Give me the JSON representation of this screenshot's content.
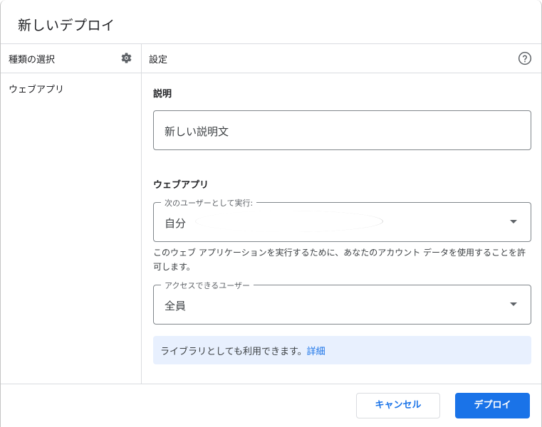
{
  "dialog": {
    "title": "新しいデプロイ"
  },
  "left_panel": {
    "header": "種類の選択",
    "items": [
      "ウェブアプリ"
    ],
    "header_icon": "gear-icon"
  },
  "right_panel": {
    "header": "設定",
    "header_icon": "help-icon",
    "description": {
      "label": "説明",
      "value": "新しい説明文"
    },
    "webapp": {
      "section_label": "ウェブアプリ",
      "execute_as": {
        "legend": "次のユーザーとして実行:",
        "value": "自分"
      },
      "helper_text": "このウェブ アプリケーションを実行するために、あなたのアカウント データを使用することを許可します。",
      "access": {
        "legend": "アクセスできるユーザー",
        "value": "全員"
      },
      "info": {
        "text": "ライブラリとしても利用できます。",
        "link": "詳細"
      }
    }
  },
  "footer": {
    "cancel_label": "キャンセル",
    "deploy_label": "デプロイ"
  },
  "colors": {
    "accent": "#1a73e8",
    "info_bg": "#e8f0fe",
    "border": "#dadce0"
  }
}
